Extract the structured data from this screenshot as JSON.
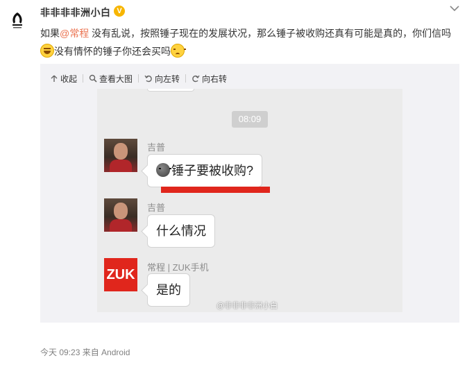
{
  "post": {
    "username": "非非非非洲小白",
    "verified_badge": "V",
    "text_prefix": "如果",
    "mention": "@常程",
    "text_main": " 没有乱说，按照锤子现在的发展状况，那么锤子被收购还真有可能是真的，你们信吗",
    "text_line2": "没有情怀的锤子你还会买吗",
    "emoji_laugh": "laughing-emoji",
    "emoji_sad": "sad-emoji",
    "timestamp": "今天 09:23",
    "source": "来自 Android"
  },
  "toolbar": {
    "collapse": "收起",
    "view_large": "查看大图",
    "rotate_left": "向左转",
    "rotate_right": "向右转"
  },
  "chat": {
    "time_chip": "08:09",
    "messages": [
      {
        "sender": "吉普",
        "text": "锤子要被收购?",
        "avatar": "photo"
      },
      {
        "sender": "吉普",
        "text": "什么情况",
        "avatar": "photo"
      },
      {
        "sender": "常程 | ZUK手机",
        "text": "是的",
        "avatar": "ZUK"
      }
    ],
    "watermark": "@非非非非洲小白"
  },
  "colors": {
    "mention": "#eb7350",
    "zuk_red": "#e0261c",
    "media_bg": "#f2f2f5"
  }
}
